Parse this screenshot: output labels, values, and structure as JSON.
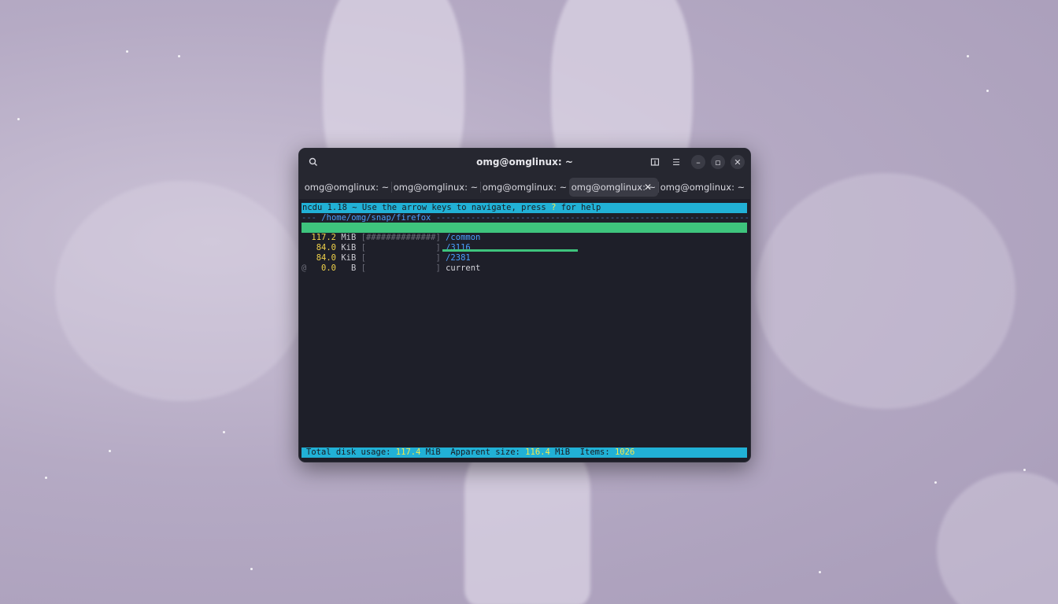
{
  "window": {
    "title": "omg@omglinux: ~",
    "icons": {
      "search": "search-icon",
      "new_tab": "new-tab-icon",
      "menu": "hamburger-menu-icon",
      "minimize": "minimize-icon",
      "maximize": "maximize-icon",
      "close": "close-icon"
    }
  },
  "tabs": [
    {
      "label": "omg@omglinux: ~",
      "active": false
    },
    {
      "label": "omg@omglinux: ~",
      "active": false
    },
    {
      "label": "omg@omglinux: ~",
      "active": false
    },
    {
      "label": "omg@omglinux: ~",
      "active": true
    },
    {
      "label": "omg@omglinux: ~",
      "active": false
    }
  ],
  "terminal": {
    "header_pre": "ncdu 1.18 ~ Use the arrow keys to navigate, press ",
    "header_key": "?",
    "header_post": " for help",
    "path_prefix": "--- ",
    "path": "/home/omg/snap/firefox",
    "path_suffix": " ----------------------------------------------------------------",
    "rows": [
      {
        "size": "117.2",
        "unit": "MiB",
        "bar": "[##############]",
        "name": "/common",
        "plain": false
      },
      {
        "size": "84.0",
        "unit": "KiB",
        "bar": "[              ]",
        "name": "/3116",
        "plain": false
      },
      {
        "size": "84.0",
        "unit": "KiB",
        "bar": "[              ]",
        "name": "/2381",
        "plain": false
      },
      {
        "size": "0.0",
        "unit": "  B",
        "bar": "[              ]",
        "name": "current",
        "plain": true,
        "marker": "@"
      }
    ],
    "footer": {
      "total_label": "Total disk usage: ",
      "total_value": "117.4",
      "total_unit": " MiB  ",
      "apparent_label": "Apparent size: ",
      "apparent_value": "116.4",
      "apparent_unit": " MiB  ",
      "items_label": "Items: ",
      "items_value": "1026"
    }
  },
  "colors": {
    "accent": "#21b1d6",
    "selection": "#3ec47d",
    "highlight": "#f2e94e",
    "dir": "#4aa0ff"
  }
}
